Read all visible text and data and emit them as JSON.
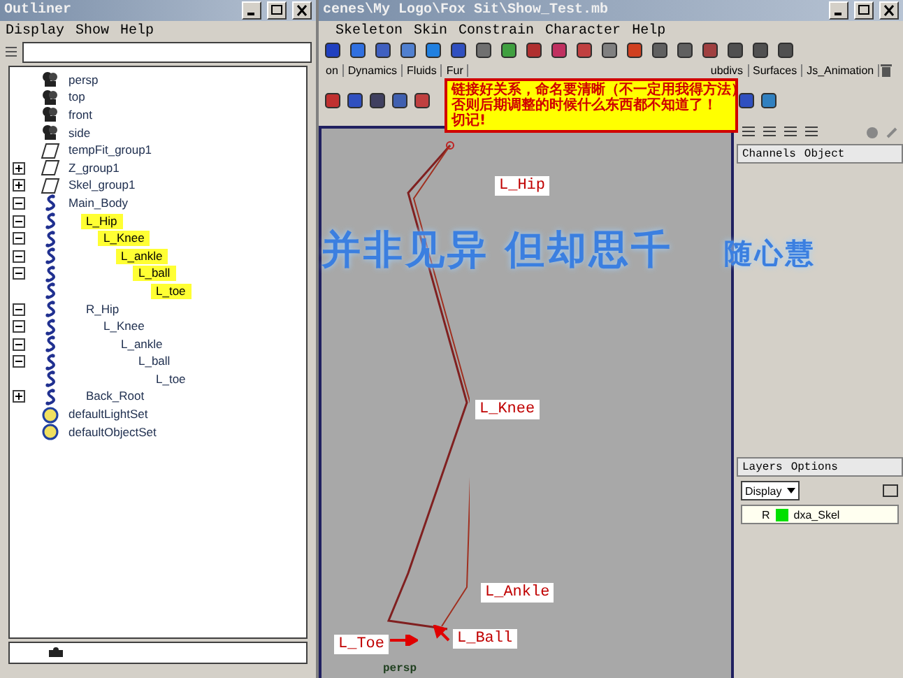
{
  "outliner": {
    "title": "Outliner",
    "menu": [
      "Display",
      "Show",
      "Help"
    ],
    "tree": [
      {
        "label": "persp",
        "kind": "camera",
        "selected": false
      },
      {
        "label": "top",
        "kind": "camera",
        "selected": false
      },
      {
        "label": "front",
        "kind": "camera",
        "selected": false
      },
      {
        "label": "side",
        "kind": "camera",
        "selected": false
      },
      {
        "label": "tempFit_group1",
        "kind": "group",
        "selected": false
      },
      {
        "label": "Z_group1",
        "kind": "group",
        "selected": false,
        "expanded": false
      },
      {
        "label": "Skel_group1",
        "kind": "group",
        "selected": false,
        "expanded": false
      },
      {
        "label": "Main_Body",
        "kind": "joint",
        "selected": false,
        "expanded": true,
        "children": [
          {
            "label": "L_Hip",
            "kind": "joint",
            "selected": true,
            "expanded": true,
            "children": [
              {
                "label": "L_Knee",
                "kind": "joint",
                "selected": true,
                "expanded": true,
                "children": [
                  {
                    "label": "L_ankle",
                    "kind": "joint",
                    "selected": true,
                    "expanded": true,
                    "children": [
                      {
                        "label": "L_ball",
                        "kind": "joint",
                        "selected": true,
                        "expanded": true,
                        "children": [
                          {
                            "label": "L_toe",
                            "kind": "joint",
                            "selected": true
                          }
                        ]
                      }
                    ]
                  }
                ]
              }
            ]
          },
          {
            "label": "R_Hip",
            "kind": "joint",
            "selected": false,
            "expanded": true,
            "children": [
              {
                "label": "L_Knee",
                "kind": "joint",
                "selected": false,
                "expanded": true,
                "children": [
                  {
                    "label": "L_ankle",
                    "kind": "joint",
                    "selected": false,
                    "expanded": true,
                    "children": [
                      {
                        "label": "L_ball",
                        "kind": "joint",
                        "selected": false,
                        "expanded": true,
                        "children": [
                          {
                            "label": "L_toe",
                            "kind": "joint",
                            "selected": false
                          }
                        ]
                      }
                    ]
                  }
                ]
              }
            ]
          },
          {
            "label": "Back_Root",
            "kind": "joint",
            "selected": false,
            "expanded": false
          }
        ]
      },
      {
        "label": "defaultLightSet",
        "kind": "set",
        "selected": false
      },
      {
        "label": "defaultObjectSet",
        "kind": "set",
        "selected": false
      }
    ]
  },
  "main_window": {
    "title": "cenes\\My Logo\\Fox Sit\\Show_Test.mb",
    "menu": [
      "Skeleton",
      "Skin",
      "Constrain",
      "Character",
      "Help"
    ],
    "shelf_tabs": [
      {
        "label": "on",
        "selected": false
      },
      {
        "label": "Dynamics",
        "selected": false
      },
      {
        "label": "Fluids",
        "selected": false
      },
      {
        "label": "Fur",
        "selected": false
      },
      {
        "label": "ubdivs",
        "selected": false
      },
      {
        "label": "Surfaces",
        "selected": false
      },
      {
        "label": "Js_Animation",
        "selected": false
      }
    ],
    "note": {
      "lines": [
        "链接好关系，命名要清晰（不一定用我得方法）",
        "否则后期调整的时候什么东西都不知道了！",
        "切记!"
      ]
    },
    "viewport": {
      "camera": "persp",
      "labels": [
        "L_Hip",
        "L_Knee",
        "L_Ankle",
        "L_Toe",
        "L_Ball"
      ]
    }
  },
  "overlay_caption": {
    "text": "并非见异 但却思千",
    "signature": "随心慧"
  },
  "channel_box": {
    "menu": [
      "Channels",
      "Object"
    ]
  },
  "layers": {
    "menu": [
      "Layers",
      "Options"
    ],
    "display": "Display",
    "items": [
      {
        "flag": "R",
        "color": "#00e000",
        "name": "dxa_Skel"
      }
    ]
  }
}
